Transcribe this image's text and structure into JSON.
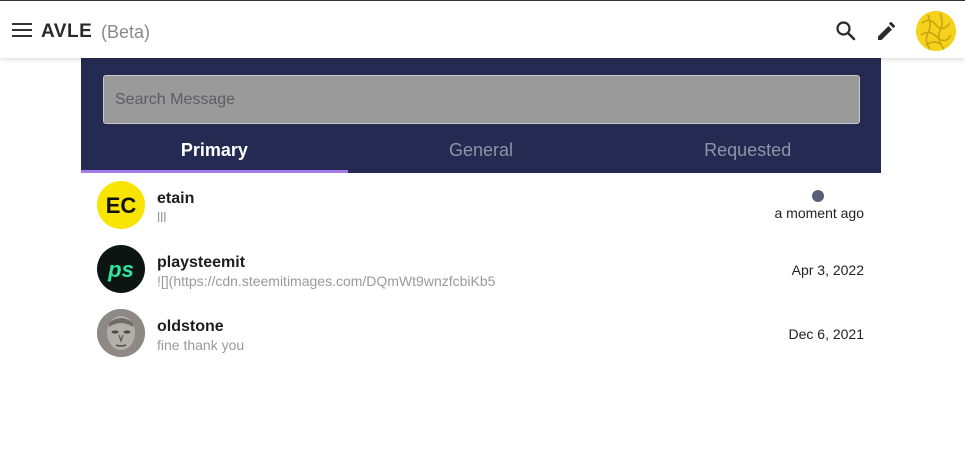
{
  "header": {
    "logo_text": "AVLE",
    "beta_label": "(Beta)"
  },
  "search": {
    "placeholder": "Search Message",
    "value": ""
  },
  "tabs": [
    {
      "label": "Primary",
      "active": true
    },
    {
      "label": "General",
      "active": false
    },
    {
      "label": "Requested",
      "active": false
    }
  ],
  "conversations": [
    {
      "name": "etain",
      "preview": "lll",
      "time": "a moment ago",
      "unread": true,
      "avatar_text": "EC"
    },
    {
      "name": "playsteemit",
      "preview": "![](https://cdn.steemitimages.com/DQmWt9wnzfcbiKb5",
      "time": "Apr 3, 2022",
      "unread": false,
      "avatar_text": "ps"
    },
    {
      "name": "oldstone",
      "preview": "fine thank you",
      "time": "Dec 6, 2021",
      "unread": false
    }
  ],
  "colors": {
    "panel_bg": "#252a52",
    "tab_indicator": "#a67ce8",
    "unread_dot": "#5a5f78",
    "etain_avatar": "#f7e400",
    "playsteemit_avatar": "#0c1512",
    "playsteemit_logo": "#2ee59d",
    "user_avatar": "#f5d21c"
  },
  "icons": {
    "menu": "menu-icon",
    "search": "search-icon",
    "edit": "pencil-icon"
  }
}
